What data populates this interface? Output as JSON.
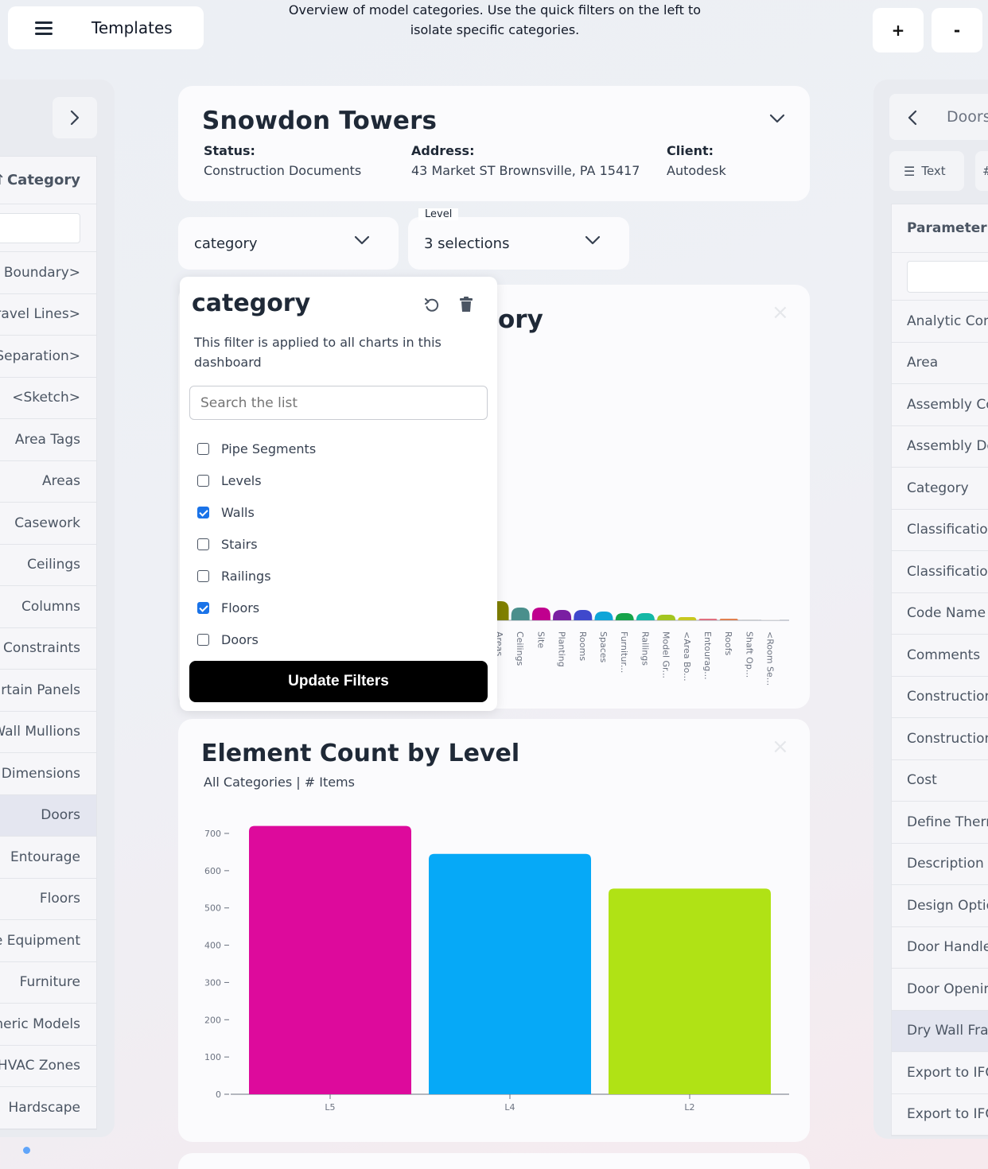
{
  "topbar": {
    "templates_label": "Templates",
    "overview_line1": "Overview of model categories. Use the quick filters on the left to",
    "overview_line2": "isolate specific categories.",
    "zoom_in": "+",
    "zoom_out": "-"
  },
  "left_sidebar": {
    "header": "Category",
    "items": [
      "<Area Boundary>",
      "<Room Travel Lines>",
      "<Room Separation>",
      "<Sketch>",
      "Area Tags",
      "Areas",
      "Casework",
      "Ceilings",
      "Columns",
      "Constraints",
      "Curtain Panels",
      "Curtain Wall Mullions",
      "Dimensions",
      "Doors",
      "Entourage",
      "Floors",
      "Furniture Equipment",
      "Furniture",
      "Generic Models",
      "HVAC Zones",
      "Hardscape"
    ],
    "active_item": "Doors"
  },
  "project": {
    "title": "Snowdon Towers",
    "status_label": "Status:",
    "status_value": "Construction Documents",
    "address_label": "Address:",
    "address_value": "43 Market ST Brownsville, PA 15417",
    "client_label": "Client:",
    "client_value": "Autodesk"
  },
  "filters": {
    "category_dropdown": "category",
    "level_tag": "Level",
    "level_dropdown": "3 selections"
  },
  "background_chart": {
    "title_fragment": "ory",
    "close": "×",
    "category_labels": [
      "Areas",
      "Ceilings",
      "Site",
      "Planting",
      "Rooms",
      "Spaces",
      "Furnitur...",
      "Railings",
      "Model Gr...",
      "<Area Bo...",
      "Entourag...",
      "Roofs",
      "Shaft Op...",
      "<Room Se..."
    ],
    "colors": [
      "#808000",
      "#4a8f8c",
      "#c0008e",
      "#7a1fa2",
      "#3f48cc",
      "#0ea5d8",
      "#16a34a",
      "#14b8a6",
      "#a3c520",
      "#c8c820",
      "#e07080",
      "#e08050",
      "#d0d0d0",
      "#e8e8e8"
    ]
  },
  "popover": {
    "title": "category",
    "description": "This filter is applied to all charts in this dashboard",
    "search_placeholder": "Search the list",
    "options": [
      {
        "label": "Pipe Segments",
        "checked": false
      },
      {
        "label": "Levels",
        "checked": false
      },
      {
        "label": "Walls",
        "checked": true
      },
      {
        "label": "Stairs",
        "checked": false
      },
      {
        "label": "Railings",
        "checked": false
      },
      {
        "label": "Floors",
        "checked": true
      },
      {
        "label": "Doors",
        "checked": false
      }
    ],
    "update_button": "Update Filters"
  },
  "element_count": {
    "title": "Element Count by Level",
    "subtitle": "All Categories | # Items",
    "close": "×"
  },
  "chart_data": {
    "type": "bar",
    "title": "Element Count by Level",
    "subtitle": "All Categories | # Items",
    "categories": [
      "L5",
      "L4",
      "L2"
    ],
    "values": [
      720,
      645,
      552
    ],
    "colors": [
      "#dd0a9c",
      "#06a9f7",
      "#b0e215"
    ],
    "ylim": [
      0,
      700
    ],
    "yticks": [
      0,
      100,
      200,
      300,
      400,
      500,
      600,
      700
    ],
    "xlabel": "",
    "ylabel": ""
  },
  "right_sidebar": {
    "title": "Doors",
    "tab_text": "Text",
    "tab_hash": "#",
    "header": "Parameter",
    "items": [
      "Analytic Construction",
      "Area",
      "Assembly Code",
      "Assembly Description",
      "Category",
      "Classification",
      "Classification",
      "Code Name",
      "Comments",
      "Construction",
      "Construction",
      "Cost",
      "Define Thermal",
      "Description",
      "Design Option",
      "Door Handle",
      "Door Opening",
      "Dry Wall Frame",
      "Export to IFC",
      "Export to IFC"
    ],
    "active_item": "Dry Wall Frame"
  }
}
